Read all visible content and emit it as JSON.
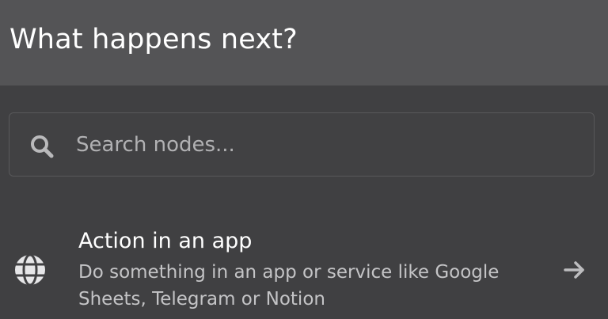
{
  "header": {
    "title": "What happens next?"
  },
  "search": {
    "placeholder": "Search nodes...",
    "icon": "search-icon"
  },
  "items": [
    {
      "title": "Action in an app",
      "description": "Do something in an app or service like Google Sheets, Telegram or Notion",
      "icon": "globe-icon",
      "trailing_icon": "arrow-right-icon"
    }
  ],
  "colors": {
    "header_bg": "#545456",
    "panel_bg": "#404042",
    "text_primary": "#ffffff",
    "text_secondary": "#c4c4c6"
  }
}
